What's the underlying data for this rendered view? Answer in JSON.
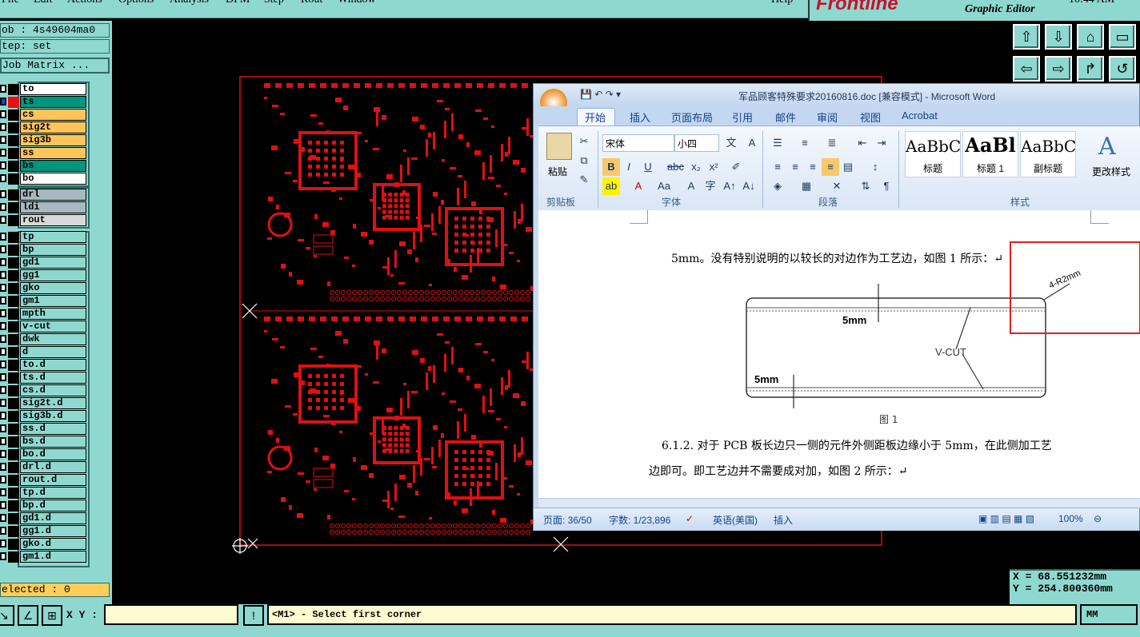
{
  "menubar": {
    "items": [
      "File",
      "Edit",
      "Actions",
      "Options",
      "Analysis",
      "DFM",
      "Step",
      "Rout",
      "Window"
    ],
    "help": "Help",
    "brand": "Frontline",
    "subtitle": "Graphic Editor",
    "time": "10:44 AM"
  },
  "job": {
    "job_label": "ob : 4s49604ma0",
    "step_label": "tep: set",
    "matrix_button": "Job Matrix ..."
  },
  "layers_board": [
    {
      "name": "to",
      "color": "#ffffff"
    },
    {
      "name": "ts",
      "color": "#00957d"
    },
    {
      "name": "cs",
      "color": "#ffc45a"
    },
    {
      "name": "sig2t",
      "color": "#ffc45a"
    },
    {
      "name": "sig3b",
      "color": "#ffc45a"
    },
    {
      "name": "ss",
      "color": "#ffc45a"
    },
    {
      "name": "bs",
      "color": "#00957d"
    },
    {
      "name": "bo",
      "color": "#ffffff"
    }
  ],
  "layers_drill": [
    {
      "name": "drl",
      "color": "#a8b8c0"
    },
    {
      "name": "ldi",
      "color": "#a8b8c0"
    },
    {
      "name": "rout",
      "color": "#d8d8d8"
    }
  ],
  "layers_misc": [
    "tp",
    "bp",
    "gd1",
    "gg1",
    "gko",
    "gm1",
    "mpth",
    "v-cut",
    "dwk",
    "d",
    "to.d",
    "ts.d",
    "cs.d",
    "sig2t.d",
    "sig3b.d",
    "ss.d",
    "bs.d",
    "bo.d",
    "drl.d",
    "rout.d",
    "tp.d",
    "bp.d",
    "gd1.d",
    "gg1.d",
    "gko.d",
    "gm1.d"
  ],
  "selected_label": "elected : 0",
  "coords": {
    "x": "X  =  68.551232mm",
    "y": "Y  =  254.800360mm"
  },
  "bottom": {
    "xy_label": "X Y :",
    "xy_value": "",
    "prompt": "<M1> - Select first corner",
    "units": "MM"
  },
  "word": {
    "title": "军品顾客特殊要求20160816.doc [兼容模式] - Microsoft Word",
    "tabs": [
      "开始",
      "插入",
      "页面布局",
      "引用",
      "邮件",
      "审阅",
      "视图",
      "Acrobat"
    ],
    "font_name": "宋体",
    "font_size": "小四",
    "paste_label": "粘贴",
    "group_labels": [
      "剪贴板",
      "字体",
      "段落",
      "样式"
    ],
    "styles": [
      {
        "sample": "AaBbC",
        "label": "标题"
      },
      {
        "sample": "AaBl",
        "label": "标题 1"
      },
      {
        "sample": "AaBbC",
        "label": "副标题"
      }
    ],
    "change_styles": "更改样式",
    "doc_line1": "5mm。没有特别说明的以较长的对边作为工艺边，如图 1 所示：↵",
    "fig_labels": {
      "r": "4-R2mm",
      "top": "5mm",
      "bottom": "5mm",
      "vcut": "V-CUT",
      "caption": "图 1"
    },
    "doc_line2": "6.1.2. 对于 PCB 板长边只一侧的元件外侧距板边缘小于 5mm，在此侧加工艺",
    "doc_line3": "边即可。即工艺边并不需要成对加，如图 2 所示：↵",
    "status": {
      "page": "页面: 36/50",
      "words": "字数: 1/23,896",
      "lang": "英语(美国)",
      "mode": "插入",
      "zoom": "100%"
    }
  }
}
